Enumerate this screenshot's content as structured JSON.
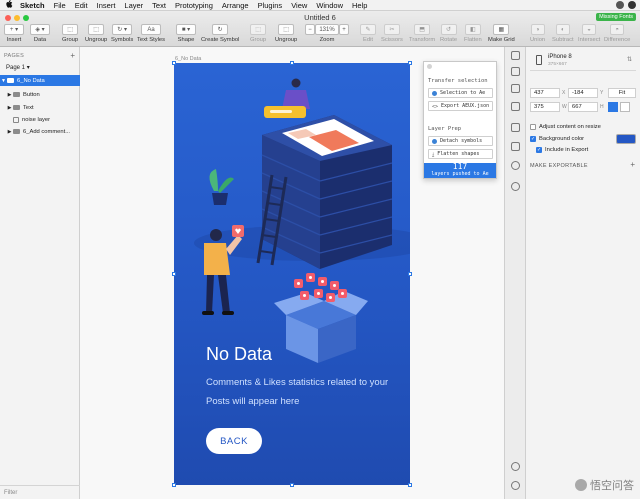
{
  "menubar": {
    "apple": "",
    "items": [
      "Sketch",
      "File",
      "Edit",
      "Insert",
      "Layer",
      "Text",
      "Prototyping",
      "Arrange",
      "Plugins",
      "View",
      "Window",
      "Help"
    ]
  },
  "window": {
    "title": "Untitled 6",
    "missing_fonts": "Missing Fonts"
  },
  "toolbar": {
    "insert": "Insert",
    "data": "Data",
    "group": "Group",
    "ungroup": "Ungroup",
    "symbols": "Symbols",
    "text_styles": "Text Styles",
    "text_styles_btn": "Aa",
    "shape": "Shape",
    "create_symbol": "Create Symbol",
    "group2": "Group",
    "ungroup2": "Ungroup",
    "zoom": "Zoom",
    "zoom_value": "131%",
    "zoom_minus": "−",
    "zoom_plus": "+",
    "edit": "Edit",
    "scissors": "Scissors",
    "transform": "Transform",
    "rotate": "Rotate",
    "flatten": "Flatten",
    "make_grid": "Make Grid",
    "union": "Union",
    "subtract": "Subtract",
    "intersect": "Intersect",
    "difference": "Difference"
  },
  "sidebar": {
    "pages_header": "PAGES",
    "page": "Page 1",
    "layers": [
      {
        "label": "6_No Data",
        "selected": true,
        "type": "artboard"
      },
      {
        "label": "Button",
        "selected": false,
        "type": "folder"
      },
      {
        "label": "Text",
        "selected": false,
        "type": "folder"
      },
      {
        "label": "noise layer",
        "selected": false,
        "type": "rect"
      },
      {
        "label": "6_Add comment...",
        "selected": false,
        "type": "folder"
      }
    ],
    "filter": "Filter"
  },
  "canvas": {
    "artboard_label": "6_No Data",
    "heading": "No Data",
    "description": "Comments & Likes statistics related to your Posts will appear here",
    "back_button": "BACK"
  },
  "plugin": {
    "section_transfer": "Transfer selection",
    "btn_selection": "Selection to Ae",
    "btn_export": "Export AEUX.json",
    "section_prep": "Layer Prep",
    "btn_detach": "Detach symbols",
    "btn_flatten": "Flatten shapes",
    "count": "117",
    "count_label": "layers pushed to Ae"
  },
  "inspector": {
    "device_name": "iPhone 8",
    "device_size": "375×667",
    "x": "437",
    "y": "-184",
    "w": "375",
    "h": "667",
    "x_label": "X",
    "y_label": "Y",
    "w_label": "W",
    "h_label": "H",
    "fit": "Fit",
    "adjust_content": "Adjust content on resize",
    "background_color": "Background color",
    "include_in_export": "Include in Export",
    "make_exportable": "MAKE EXPORTABLE",
    "bg_swatch": "#2457c4"
  },
  "watermark": "悟空问答",
  "colors": {
    "accent": "#2b78e4",
    "artboard_bg": "#2457c4",
    "traffic_red": "#fc5f57",
    "traffic_yellow": "#fdbc2e",
    "traffic_green": "#28c840"
  }
}
